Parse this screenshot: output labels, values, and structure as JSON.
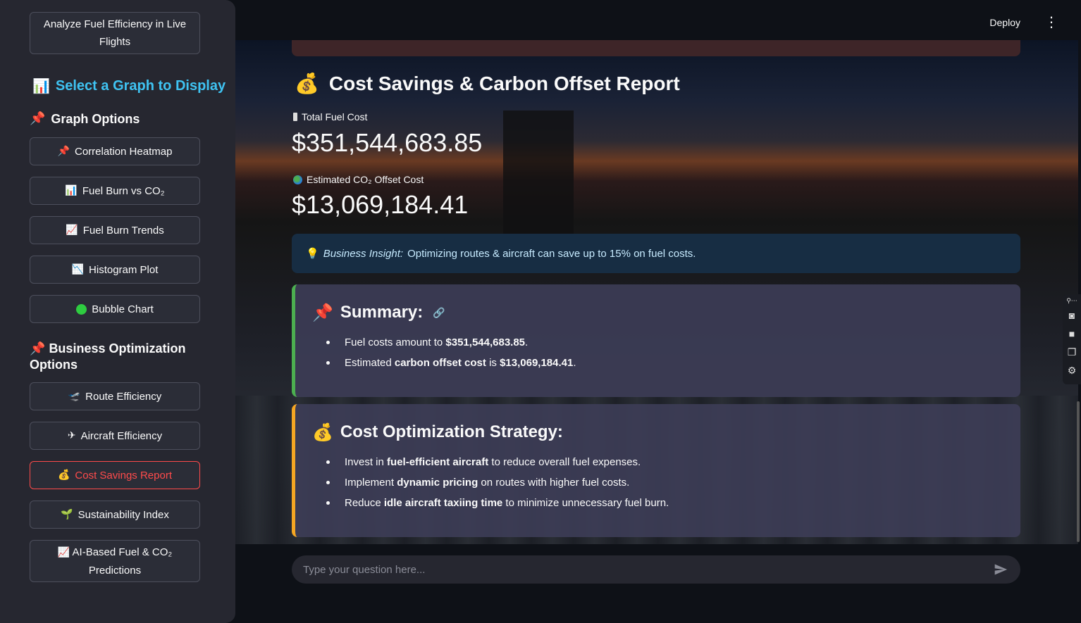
{
  "sidebar": {
    "top_button": {
      "line1": "Analyze Fuel Efficiency in Live",
      "line2": "Flights"
    },
    "select_heading": "Select a Graph to Display",
    "graph_options_heading": "Graph Options",
    "graph_buttons": [
      {
        "icon": "📌",
        "label": "Correlation Heatmap"
      },
      {
        "icon": "📊",
        "label": "Fuel Burn vs CO₂"
      },
      {
        "icon": "📈",
        "label": "Fuel Burn Trends"
      },
      {
        "icon": "📉",
        "label": "Histogram Plot"
      },
      {
        "icon": "🟢",
        "label": "Bubble Chart"
      }
    ],
    "business_heading_line1": "Business Optimization",
    "business_heading_line2": "Options",
    "business_buttons": [
      {
        "icon": "🛫",
        "label": "Route Efficiency"
      },
      {
        "icon": "✈",
        "label": "Aircraft Efficiency"
      },
      {
        "icon": "💰",
        "label": "Cost Savings Report"
      },
      {
        "icon": "🌱",
        "label": "Sustainability Index"
      }
    ],
    "ai_button": {
      "icon": "📈",
      "line1": "AI-Based Fuel & CO₂",
      "line2": "Predictions"
    },
    "active_button": "Cost Savings Report"
  },
  "header": {
    "deploy_label": "Deploy",
    "menu_icon": "⋮"
  },
  "report": {
    "title": "Cost Savings & Carbon Offset Report",
    "title_icon": "💰",
    "fuel_cost_label": "Total Fuel Cost",
    "fuel_cost_value": "$351,544,683.85",
    "offset_label": "Estimated CO₂ Offset Cost",
    "offset_value": "$13,069,184.41",
    "insight_icon": "💡",
    "insight_prefix": "Business Insight:",
    "insight_text": "Optimizing routes & aircraft can save up to 15% on fuel costs."
  },
  "summary": {
    "title": "Summary:",
    "items": [
      {
        "pre": "Fuel costs amount to ",
        "bold": "$351,544,683.85",
        "post": "."
      },
      {
        "pre": "Estimated ",
        "bold": "carbon offset cost",
        "mid": " is ",
        "bold2": "$13,069,184.41",
        "post": "."
      }
    ]
  },
  "strategy": {
    "title": "Cost Optimization Strategy:",
    "items": [
      {
        "pre": "Invest in ",
        "bold": "fuel-efficient aircraft",
        "post": " to reduce overall fuel expenses."
      },
      {
        "pre": "Implement ",
        "bold": "dynamic pricing",
        "post": " on routes with higher fuel costs."
      },
      {
        "pre": "Reduce ",
        "bold": "idle aircraft taxiing time",
        "post": " to minimize unnecessary fuel burn."
      }
    ]
  },
  "chat": {
    "placeholder": "Type your question here..."
  },
  "colors": {
    "accent_active": "#ff4b4b",
    "select_heading": "#3fc3f2",
    "summary_border": "#4caf50",
    "strategy_border": "#f5a623",
    "insight_bg": "#172d43"
  }
}
